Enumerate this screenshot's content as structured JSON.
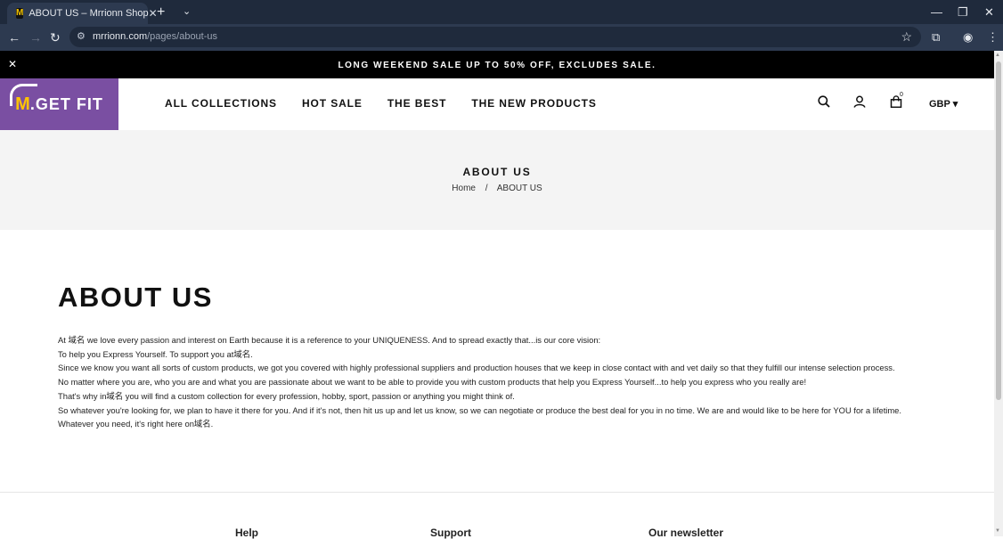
{
  "browser": {
    "tab_title": "ABOUT US – Mrrionn Shop",
    "tab_favicon": "M",
    "tab_close": "✕",
    "new_tab": "+",
    "tab_list": "⌄",
    "minimize": "—",
    "restore": "❐",
    "close": "✕",
    "back": "←",
    "forward": "→",
    "reload": "↻",
    "site_info": "⚙",
    "url_domain": "mrrionn.com",
    "url_path": "/pages/about-us",
    "star": "☆",
    "extensions": "⧉",
    "profile": "◉",
    "menu": "⋮"
  },
  "announcement": {
    "close": "✕",
    "text": "LONG WEEKEND SALE UP TO 50% OFF, EXCLUDES SALE."
  },
  "header": {
    "logo_m": "M",
    "logo_rest": ".GET FIT",
    "nav": [
      "ALL COLLECTIONS",
      "HOT SALE",
      "THE BEST",
      "THE NEW PRODUCTS"
    ],
    "cart_count": "0",
    "currency": "GBP ▾"
  },
  "hero": {
    "title": "ABOUT US",
    "crumb_home": "Home",
    "crumb_sep": "/",
    "crumb_current": "ABOUT US"
  },
  "about": {
    "heading": "ABOUT US",
    "lines": [
      "At 域名 we love every passion and interest on Earth because it is a reference to your UNIQUENESS. And to spread exactly that...is our core vision:",
      "To help you Express Yourself. To support you at域名.",
      "Since we know you want all sorts of custom products, we got you covered with highly professional suppliers and production houses that we keep in close contact with and vet daily so that they fulfill our intense selection process.",
      "No matter where you are, who you are and what you are passionate about we want to be able to provide you with custom products that help you Express Yourself...to help you express who you really are!",
      "That's why in域名 you will find a custom collection for every profession, hobby, sport, passion or anything you might think of.",
      "So whatever you're looking for, we plan to have it there for you. And if it's not, then hit us up and let us know, so we can negotiate or produce the best deal for you in no time. We are and would like to be here for YOU for a lifetime.",
      "Whatever you need, it's right here on域名."
    ]
  },
  "footer": {
    "col1": "Help",
    "col2": "Support",
    "col3": "Our newsletter"
  },
  "colors": {
    "chrome_dark": "#1f2a3c",
    "chrome_toolbar": "#2d3a50",
    "logo_bg": "#7a4fa2",
    "logo_accent": "#ffc400",
    "announce_bg": "#000000",
    "hero_bg": "#f4f4f4"
  }
}
